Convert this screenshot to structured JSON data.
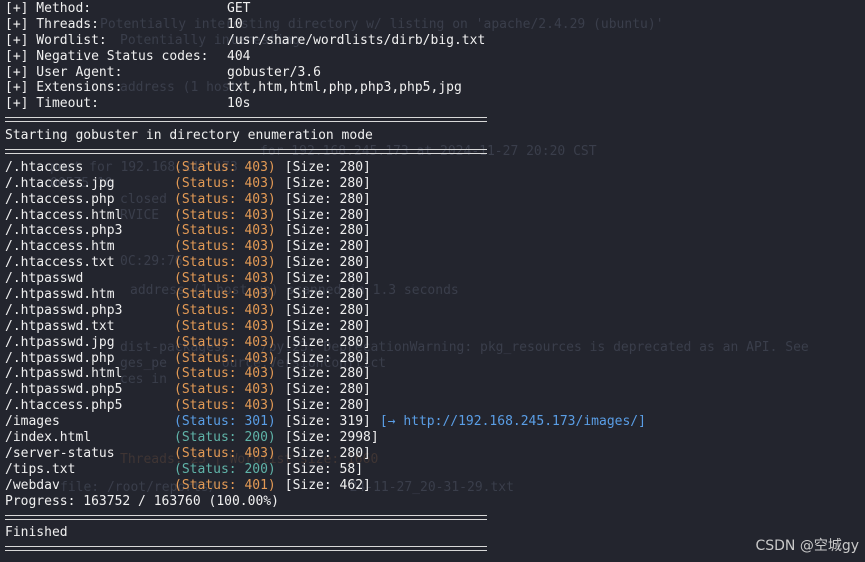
{
  "config": [
    {
      "key": "[+] Method:",
      "value": "GET"
    },
    {
      "key": "[+] Threads:",
      "value": "10"
    },
    {
      "key": "[+] Wordlist:",
      "value": "/usr/share/wordlists/dirb/big.txt"
    },
    {
      "key": "[+] Negative Status codes:",
      "value": "404"
    },
    {
      "key": "[+] User Agent:",
      "value": "gobuster/3.6"
    },
    {
      "key": "[+] Extensions:",
      "value": "txt,htm,html,php,php3,php5,jpg"
    },
    {
      "key": "[+] Timeout:",
      "value": "10s"
    }
  ],
  "start_message": "Starting gobuster in directory enumeration mode",
  "results": [
    {
      "path": "/.htaccess",
      "status": "(Status: 403)",
      "size": "[Size: 280]",
      "redirect": ""
    },
    {
      "path": "/.htaccess.jpg",
      "status": "(Status: 403)",
      "size": "[Size: 280]",
      "redirect": ""
    },
    {
      "path": "/.htaccess.php",
      "status": "(Status: 403)",
      "size": "[Size: 280]",
      "redirect": ""
    },
    {
      "path": "/.htaccess.html",
      "status": "(Status: 403)",
      "size": "[Size: 280]",
      "redirect": ""
    },
    {
      "path": "/.htaccess.php3",
      "status": "(Status: 403)",
      "size": "[Size: 280]",
      "redirect": ""
    },
    {
      "path": "/.htaccess.htm",
      "status": "(Status: 403)",
      "size": "[Size: 280]",
      "redirect": ""
    },
    {
      "path": "/.htaccess.txt",
      "status": "(Status: 403)",
      "size": "[Size: 280]",
      "redirect": ""
    },
    {
      "path": "/.htpasswd",
      "status": "(Status: 403)",
      "size": "[Size: 280]",
      "redirect": ""
    },
    {
      "path": "/.htpasswd.htm",
      "status": "(Status: 403)",
      "size": "[Size: 280]",
      "redirect": ""
    },
    {
      "path": "/.htpasswd.php3",
      "status": "(Status: 403)",
      "size": "[Size: 280]",
      "redirect": ""
    },
    {
      "path": "/.htpasswd.txt",
      "status": "(Status: 403)",
      "size": "[Size: 280]",
      "redirect": ""
    },
    {
      "path": "/.htpasswd.jpg",
      "status": "(Status: 403)",
      "size": "[Size: 280]",
      "redirect": ""
    },
    {
      "path": "/.htpasswd.php",
      "status": "(Status: 403)",
      "size": "[Size: 280]",
      "redirect": ""
    },
    {
      "path": "/.htpasswd.html",
      "status": "(Status: 403)",
      "size": "[Size: 280]",
      "redirect": ""
    },
    {
      "path": "/.htpasswd.php5",
      "status": "(Status: 403)",
      "size": "[Size: 280]",
      "redirect": ""
    },
    {
      "path": "/.htaccess.php5",
      "status": "(Status: 403)",
      "size": "[Size: 280]",
      "redirect": ""
    },
    {
      "path": "/images",
      "status": "(Status: 301)",
      "size": "[Size: 319]",
      "redirect": "[→ http://192.168.245.173/images/]"
    },
    {
      "path": "/index.html",
      "status": "(Status: 200)",
      "size": "[Size: 2998]",
      "redirect": ""
    },
    {
      "path": "/server-status",
      "status": "(Status: 403)",
      "size": "[Size: 280]",
      "redirect": ""
    },
    {
      "path": "/tips.txt",
      "status": "(Status: 200)",
      "size": "[Size: 58]",
      "redirect": ""
    },
    {
      "path": "/webdav",
      "status": "(Status: 401)",
      "size": "[Size: 462]",
      "redirect": ""
    }
  ],
  "progress": "Progress: 163752 / 163760 (100.00%)",
  "finished_message": "Finished",
  "watermark": "CSDN @空城gy",
  "colors": {
    "background": "#23252e",
    "text": "#f0f0f0",
    "status_403": "#e39a55",
    "status_301": "#5a9ee6",
    "status_200": "#5fb3a8"
  }
}
